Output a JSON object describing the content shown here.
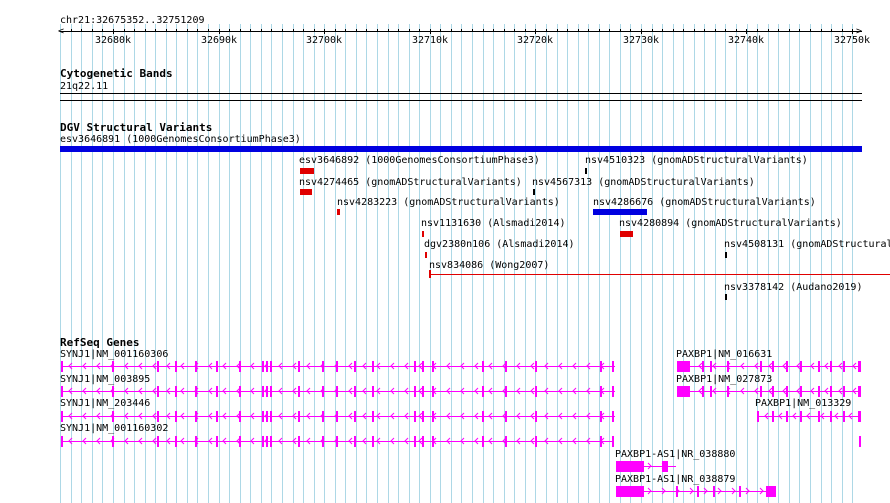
{
  "location": "chr21:32675352..32751209",
  "ruler": {
    "ticks": [
      "32680k",
      "32690k",
      "32700k",
      "32710k",
      "32720k",
      "32730k",
      "32740k",
      "32750k"
    ]
  },
  "tracks": {
    "cytoband": {
      "title": "Cytogenetic Bands",
      "band": "21q22.11"
    },
    "dgv": {
      "title": "DGV Structural Variants",
      "features": [
        {
          "label": "esv3646891 (1000GenomesConsortiumPhase3)",
          "color": "#0000e0"
        },
        {
          "label": "esv3646892 (1000GenomesConsortiumPhase3)",
          "color": "#e00000"
        },
        {
          "label": "nsv4510323 (gnomADStructuralVariants)",
          "color": "#000000"
        },
        {
          "label": "nsv4274465 (gnomADStructuralVariants)",
          "color": "#e00000"
        },
        {
          "label": "nsv4567313 (gnomADStructuralVariants)",
          "color": "#000000"
        },
        {
          "label": "nsv4283223 (gnomADStructuralVariants)",
          "color": "#e00000"
        },
        {
          "label": "nsv4286676 (gnomADStructuralVariants)",
          "color": "#0000e0"
        },
        {
          "label": "nsv1131630 (Alsmadi2014)",
          "color": "#e00000"
        },
        {
          "label": "nsv4280894 (gnomADStructuralVariants)",
          "color": "#e00000"
        },
        {
          "label": "dgv2380n106 (Alsmadi2014)",
          "color": "#e00000"
        },
        {
          "label": "nsv4508131 (gnomADStructural",
          "color": "#000000"
        },
        {
          "label": "nsv834086 (Wong2007)",
          "color": "#e00000"
        },
        {
          "label": "nsv3378142 (Audano2019)",
          "color": "#000000"
        }
      ]
    },
    "refseq": {
      "title": "RefSeq Genes",
      "gene_color": "#ff00ff",
      "transcripts": [
        {
          "label": "SYNJ1|NM_001160306"
        },
        {
          "label": "SYNJ1|NM_003895"
        },
        {
          "label": "SYNJ1|NM_203446"
        },
        {
          "label": "SYNJ1|NM_001160302"
        },
        {
          "label": "PAXBP1|NM_016631"
        },
        {
          "label": "PAXBP1|NM_027873"
        },
        {
          "label": "PAXBP1|NM_013329"
        },
        {
          "label": "PAXBP1-AS1|NR_038880"
        },
        {
          "label": "PAXBP1-AS1|NR_038879"
        }
      ]
    }
  },
  "colors": {
    "grid": "#add8e6",
    "variant_red": "#e00000",
    "variant_blue": "#0000e0",
    "gene": "#ff00ff"
  }
}
